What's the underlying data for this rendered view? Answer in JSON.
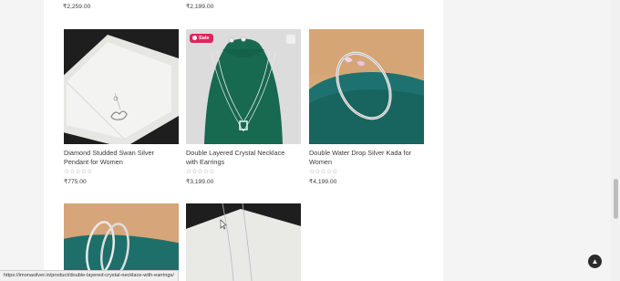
{
  "top_prices": [
    "₹2,259.00",
    "₹2,199.00"
  ],
  "products": [
    {
      "title_line1": "Diamond Studded Swan Silver",
      "title_line2": "Pendant for Women",
      "rating": "☆☆☆☆☆",
      "price": "₹775.00"
    },
    {
      "title_line1": "Double Layered Crystal Necklace",
      "title_line2": "with Earrings",
      "rating": "☆☆☆☆☆",
      "price": "₹3,199.00",
      "badge": "Sale"
    },
    {
      "title_line1": "Double Water Drop Silver Kada for",
      "title_line2": "Women",
      "rating": "☆☆☆☆☆",
      "price": "₹4,199.00"
    }
  ],
  "status_bar": {
    "url": "https://imonasilver.in/product/double-layered-crystal-necklace-with-earrings/"
  },
  "back_to_top_icon": "▲",
  "colors": {
    "sale_badge": "#e0245e",
    "teal_bg": "#1e6f6a",
    "green_bg": "#17694f"
  }
}
